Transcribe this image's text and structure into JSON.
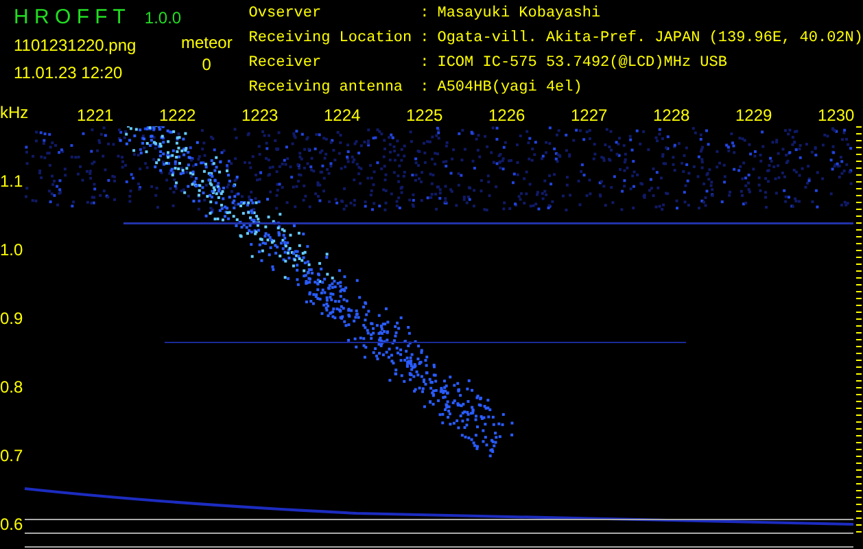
{
  "app": {
    "name": "H R O F F T",
    "version": "1.0.0"
  },
  "file": {
    "name": "1101231220.png",
    "datetime": "11.01.23 12:20"
  },
  "counter": {
    "label": "meteor",
    "value": "0"
  },
  "info": [
    {
      "label": "Ovserver",
      "separator": ":",
      "value": "Masayuki Kobayashi"
    },
    {
      "label": "Receiving Location",
      "separator": ":",
      "value": "Ogata-vill. Akita-Pref. JAPAN (139.96E, 40.02N)"
    },
    {
      "label": "Receiver",
      "separator": ":",
      "value": "ICOM IC-575 53.7492(@LCD)MHz USB"
    },
    {
      "label": "Receiving antenna",
      "separator": ":",
      "value": "A504HB(yagi 4el)"
    }
  ],
  "spectrogram": {
    "unit": "kHz",
    "x_labels": [
      "1221",
      "1222",
      "1223",
      "1224",
      "1225",
      "1226",
      "1227",
      "1228",
      "1229",
      "1230"
    ],
    "y_labels": [
      "1.1",
      "1.0",
      "0.9",
      "0.8",
      "0.7",
      "0.6"
    ]
  }
}
